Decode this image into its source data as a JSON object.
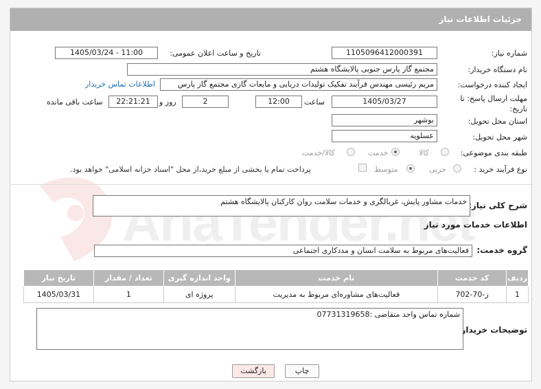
{
  "header": {
    "title": "جزئیات اطلاعات نیاز"
  },
  "fields": {
    "need_number": {
      "label": "شماره نیاز:",
      "value": "1105096412000391"
    },
    "announce_datetime": {
      "label": "تاریخ و ساعت اعلان عمومی:",
      "value": "1405/03/24 - 11:00"
    },
    "buyer_org": {
      "label": "نام دستگاه خریدار:",
      "value": "مجتمع گاز پارس جنوبی  پالایشگاه هشتم"
    },
    "requester": {
      "label": "ایجاد کننده درخواست:",
      "value": "مریم رئیسی مهندس فرآیند تفکیک تولیدات دریایی و مایعات گازی مجتمع گاز پارس",
      "contact_link": "اطلاعات تماس خریدار"
    },
    "deadline": {
      "label_line1": "مهلت ارسال پاسخ: تا",
      "label_line2": "تاریخ:",
      "date": "1405/03/27",
      "time_label": "ساعت",
      "time": "12:00",
      "days": "2",
      "days_label": "روز و",
      "remaining": "22:21:21",
      "remaining_label": "ساعت باقی مانده"
    },
    "delivery_province": {
      "label": "استان محل تحویل:",
      "value": "بوشهر"
    },
    "delivery_city": {
      "label": "شهر محل تحویل:",
      "value": "عسلویه"
    },
    "category": {
      "label": "طبقه بندی موضوعی:",
      "options": [
        "کالا",
        "خدمت",
        "کالا/خدمت"
      ],
      "selected": "خدمت"
    },
    "process_type": {
      "label": "نوع فرآیند خرید :",
      "options": [
        "جزیی",
        "متوسط"
      ],
      "selected": "متوسط",
      "payment_note": "پرداخت تمام یا بخشی از مبلغ خرید،از محل \"اسناد خزانه اسلامی\" خواهد بود."
    }
  },
  "summary": {
    "label": "شرح کلی نیاز:",
    "value": "خدمات مشاور پایش، غربالگری و خدمات سلامت روان کارکنان پالایشگاه هشتم"
  },
  "services_section": {
    "title": "اطلاعات خدمات مورد نیاز",
    "group_label": "گروه خدمت:",
    "group_value": "فعالیت‌های مربوط به سلامت انسان و مددکاری اجتماعی"
  },
  "table": {
    "headers": [
      "ردیف",
      "کد خدمت",
      "نام خدمت",
      "واحد اندازه گیری",
      "تعداد / مقدار",
      "تاریخ نیاز"
    ],
    "rows": [
      [
        "1",
        "ز-70-702",
        "فعالیت‌های مشاوره‌ای مربوط به مدیریت",
        "پروژه ای",
        "1",
        "1405/03/31"
      ]
    ]
  },
  "buyer_notes": {
    "label": "توضیحات خریدار:",
    "value": "شماره تماس واحد متقاضی :07731319658"
  },
  "buttons": {
    "print": "چاپ",
    "back": "بازگشت"
  },
  "colors": {
    "header_bg": "#b0b0b0",
    "link": "#1a6fb0",
    "back_button_bg": "#fde8e8"
  },
  "watermark": {
    "text": "AriaTender.net"
  }
}
